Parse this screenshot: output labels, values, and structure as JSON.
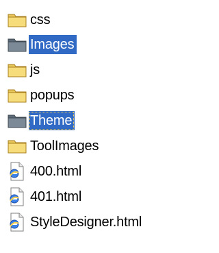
{
  "items": [
    {
      "name": "css",
      "type": "folder",
      "selected": false,
      "focused": false
    },
    {
      "name": "Images",
      "type": "folder",
      "selected": true,
      "focused": false
    },
    {
      "name": "js",
      "type": "folder",
      "selected": false,
      "focused": false
    },
    {
      "name": "popups",
      "type": "folder",
      "selected": false,
      "focused": false
    },
    {
      "name": "Theme",
      "type": "folder",
      "selected": true,
      "focused": true
    },
    {
      "name": "ToolImages",
      "type": "folder",
      "selected": false,
      "focused": false
    },
    {
      "name": "400.html",
      "type": "ie-document",
      "selected": false,
      "focused": false
    },
    {
      "name": "401.html",
      "type": "ie-document",
      "selected": false,
      "focused": false
    },
    {
      "name": "StyleDesigner.html",
      "type": "ie-document",
      "selected": false,
      "focused": false
    }
  ],
  "colors": {
    "selection": "#316ac5",
    "folder_yellow": "#f5d36a",
    "folder_selected": "#5a6b7a",
    "ie_blue": "#2a6fd6"
  }
}
